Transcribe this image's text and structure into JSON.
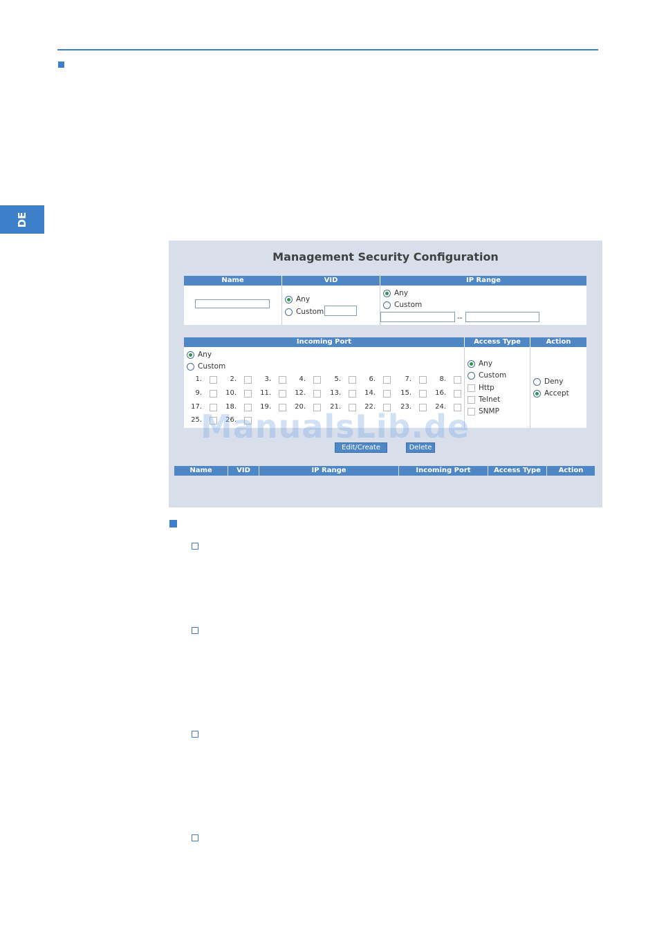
{
  "sidebar": {
    "language_tab": "DE"
  },
  "panel": {
    "title": "Management Security Configuration",
    "rule_table": {
      "headers": {
        "name": "Name",
        "vid": "VID",
        "ip_range": "IP Range"
      },
      "vid_options": {
        "any": "Any",
        "custom": "Custom"
      },
      "vid_selected": "Any",
      "ip_options": {
        "any": "Any",
        "custom": "Custom"
      },
      "ip_selected": "Any",
      "ip_separator": "--"
    },
    "port_table": {
      "headers": {
        "incoming_port": "Incoming Port",
        "access_type": "Access Type",
        "action": "Action"
      },
      "port_options": {
        "any": "Any",
        "custom": "Custom"
      },
      "port_selected": "Any",
      "ports": [
        "1.",
        "2.",
        "3.",
        "4.",
        "5.",
        "6.",
        "7.",
        "8.",
        "9.",
        "10.",
        "11.",
        "12.",
        "13.",
        "14.",
        "15.",
        "16.",
        "17.",
        "18.",
        "19.",
        "20.",
        "21.",
        "22.",
        "23.",
        "24.",
        "25.",
        "26."
      ],
      "access_options": {
        "any": "Any",
        "custom": "Custom",
        "http": "Http",
        "telnet": "Telnet",
        "snmp": "SNMP"
      },
      "access_selected": "Any",
      "action_options": {
        "deny": "Deny",
        "accept": "Accept"
      },
      "action_selected": "Accept"
    },
    "buttons": {
      "edit_create": "Edit/Create",
      "delete": "Delete"
    },
    "list_headers": [
      "Name",
      "VID",
      "IP Range",
      "Incoming Port",
      "Access Type",
      "Action"
    ]
  },
  "watermark": "ManualsLib.de",
  "colors": {
    "accent": "#3d7fc9",
    "header_bar": "#4f87c5",
    "panel_bg": "#d8dfeb"
  }
}
